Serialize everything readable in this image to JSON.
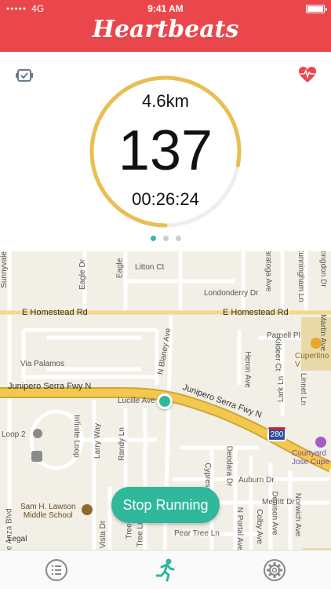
{
  "status_bar": {
    "carrier": "4G",
    "time": "9:41 AM"
  },
  "app_title": "Heartbeats",
  "stats": {
    "distance": "4.6km",
    "heart_rate": "137",
    "duration": "00:26:24",
    "progress": 0.78,
    "pager_count": 3,
    "pager_active": 0
  },
  "map": {
    "streets": [
      "Litton Ct",
      "Londonderry Dr",
      "E Homestead Rd",
      "E Homestead Rd",
      "Parnell Pl",
      "Via Palamos",
      "N Blaney Ave",
      "Junipero Serra Fwy N",
      "Junipero Serra Fwy N",
      "Lucille Ave",
      "Kildeer Ct",
      "Heron Ave",
      "Infinite Loop",
      "Larry Way",
      "Randy Ln",
      "Loop 2",
      "Cypress",
      "Deodara Dr",
      "Auburn Dr",
      "Merritt Dr",
      "Colby Ave",
      "Denison Ave",
      "Norwich Ave",
      "Lark Ln",
      "Linnet Ln",
      "Pear Tree Ln",
      "Vista Dr",
      "Tree Ln",
      "Tree Ln",
      "N Portal Ave",
      "Eagle",
      "Saratoga Ave",
      "Cunningham Ln",
      "Longdon Dr",
      "Martin Ave",
      "Eagle Dr",
      "De Anza Blvd",
      "Sunnyvale"
    ],
    "highway_shield": "280",
    "poi_cupertino": "Cupertino V",
    "poi_courtyard": "Courtyard\nJose Cupe",
    "poi_school": "Sam H. Lawson\nMiddle School",
    "legal": "Legal"
  },
  "stop_button": "Stop Running",
  "tabs": [
    "list-icon",
    "running-icon",
    "gear-icon"
  ],
  "colors": {
    "header": "#e9474c",
    "accent": "#3bb9a2",
    "ring": "#e7bf52",
    "ring_track": "#eeeeee"
  }
}
